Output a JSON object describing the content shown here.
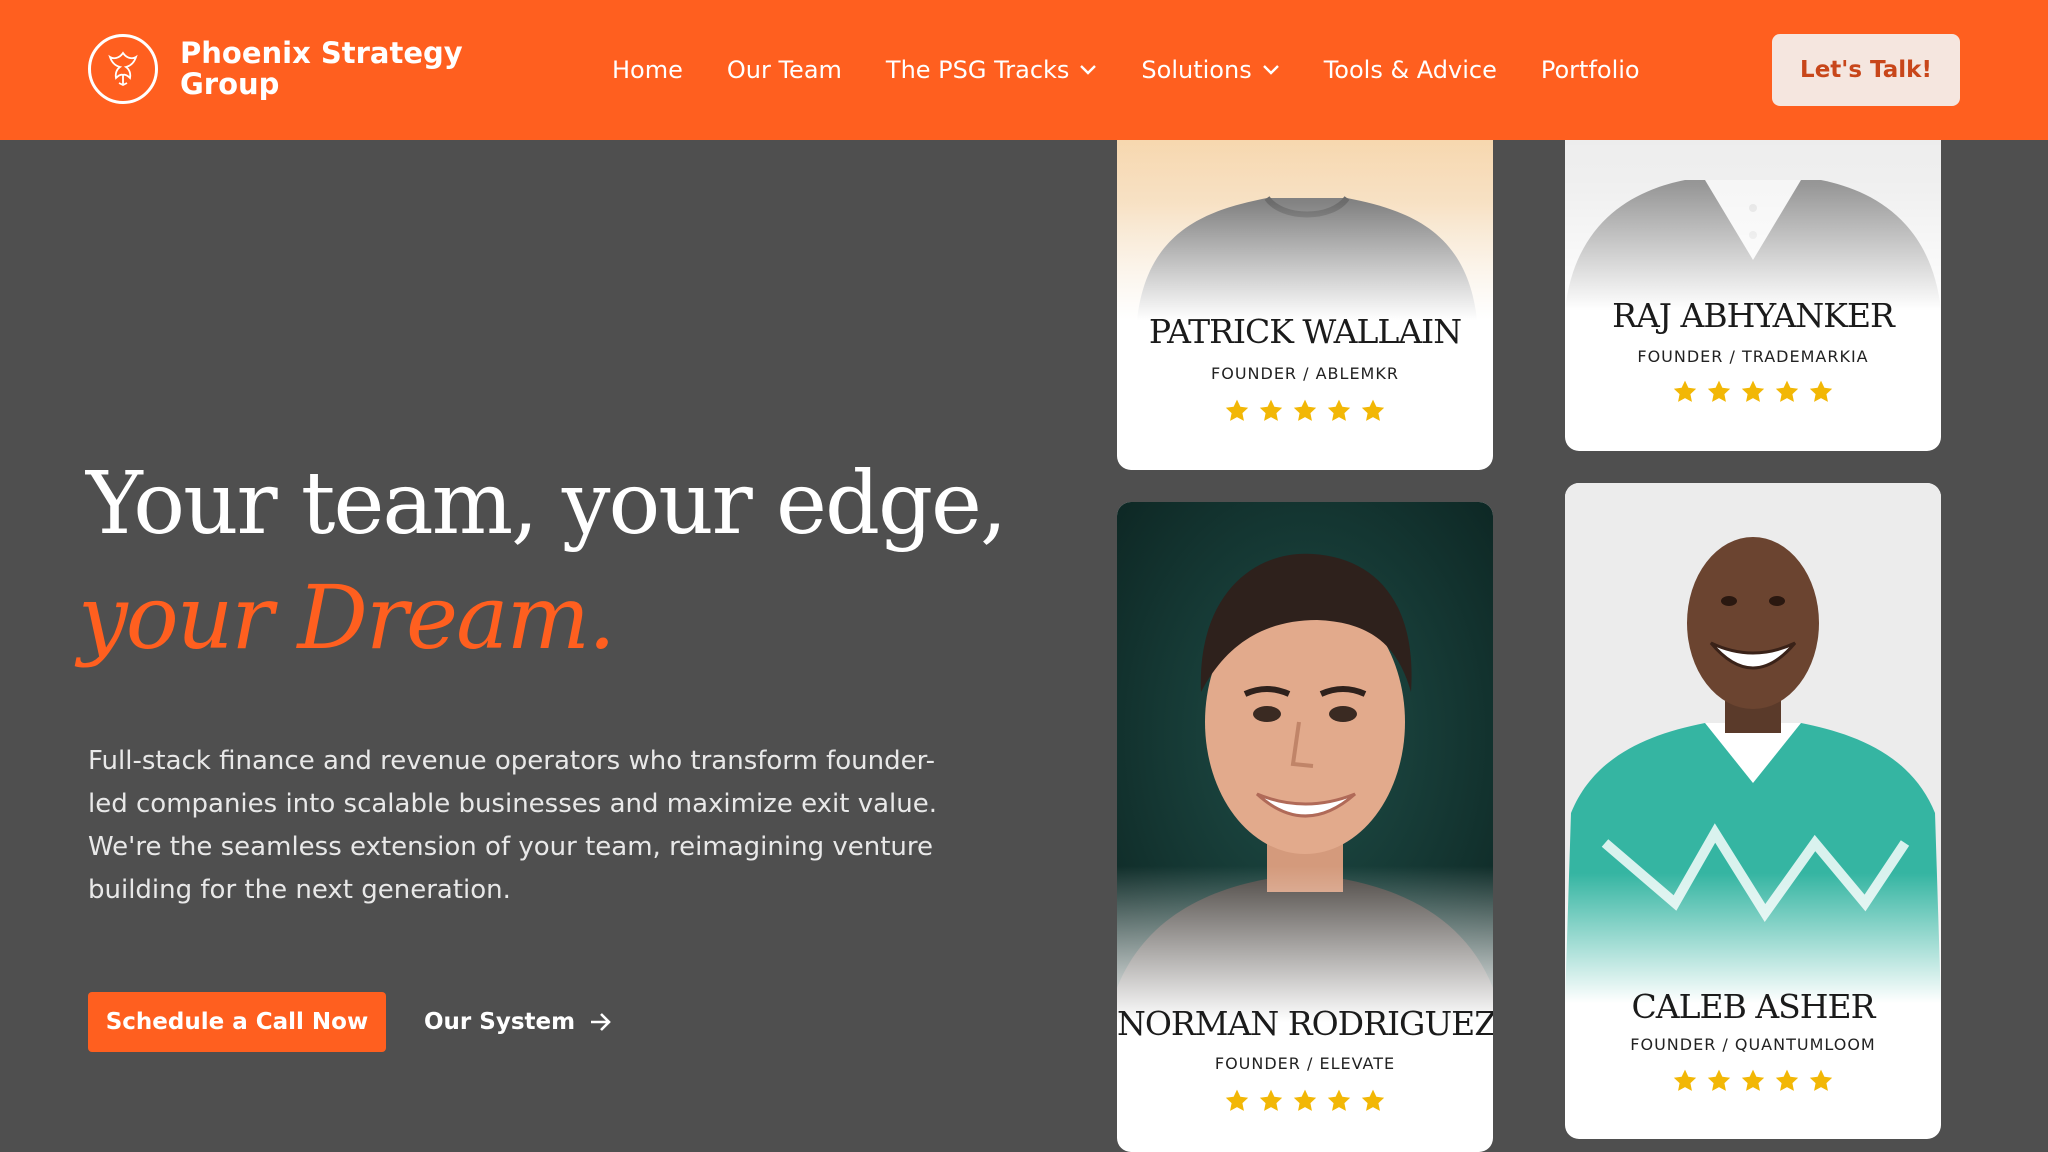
{
  "brand": {
    "name": "Phoenix Strategy Group",
    "accent": "#ff5f1f",
    "background": "#4f4f4f"
  },
  "nav": {
    "items": [
      {
        "label": "Home",
        "has_dropdown": false
      },
      {
        "label": "Our Team",
        "has_dropdown": false
      },
      {
        "label": "The PSG Tracks",
        "has_dropdown": true
      },
      {
        "label": "Solutions",
        "has_dropdown": true
      },
      {
        "label": "Tools & Advice",
        "has_dropdown": false
      },
      {
        "label": "Portfolio",
        "has_dropdown": false
      }
    ],
    "cta": "Let's Talk!"
  },
  "hero": {
    "title": "Your team, your edge,",
    "accent": "your Dream.",
    "description": "Full-stack finance and revenue operators who transform founder-led companies into scalable businesses and maximize exit value. We're the seamless extension of your team, reimagining venture building for the next generation.",
    "primary_button": "Schedule a Call Now",
    "secondary_button": "Our System"
  },
  "testimonials": [
    {
      "name": "PATRICK WALLAIN",
      "role": "FOUNDER / ABLEMKR",
      "rating": 5
    },
    {
      "name": "RAJ ABHYANKER",
      "role": "FOUNDER / TRADEMARKIA",
      "rating": 5
    },
    {
      "name": "NORMAN RODRIGUEZ",
      "role": "FOUNDER / ELEVATE",
      "rating": 5
    },
    {
      "name": "CALEB ASHER",
      "role": "FOUNDER / QUANTUMLOOM",
      "rating": 5
    }
  ],
  "icons": {
    "logo": "phoenix-icon",
    "dropdown": "chevron-down-icon",
    "arrow": "arrow-right-icon",
    "rating": "star-icon"
  },
  "star_color": "#f2b705"
}
